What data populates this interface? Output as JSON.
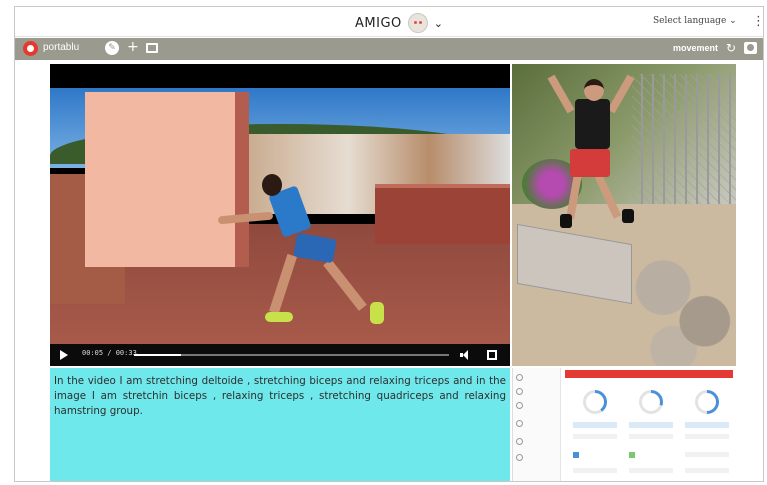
{
  "header": {
    "title": "AMIGO",
    "language_label": "Select language",
    "language_chevron": "⌄",
    "brand_chevron": "⌄",
    "kebab": "⋮"
  },
  "toolbar": {
    "app_name": "portablu",
    "mode_label": "movement",
    "pencil": "✎",
    "plus": "+",
    "refresh": "↻"
  },
  "video": {
    "time": "00:05 / 00:33",
    "progress": 0.15,
    "icons": [
      "play-icon",
      "volume-icon",
      "fullscreen-icon"
    ]
  },
  "caption": {
    "text": "In the video I am stretching deltoide , stretching biceps and relaxing triceps and in the image I am stretchin biceps , relaxing triceps , stretching quadriceps and relaxing hamstring group."
  },
  "mini_dashboard": {
    "header_color": "#e53935",
    "side_items": [
      "",
      "",
      "",
      "",
      "",
      "",
      ""
    ],
    "columns": [
      {
        "ring_color": "#4a90d9",
        "ring_fraction": 0.4
      },
      {
        "ring_color": "#4a90d9",
        "ring_fraction": 0.3
      },
      {
        "ring_color": "#4a90d9",
        "ring_fraction": 0.5
      }
    ]
  },
  "colors": {
    "toolbar_bg": "#9a9a8e",
    "caption_bg": "#6ee8ea",
    "logo_red": "#e5392d"
  }
}
